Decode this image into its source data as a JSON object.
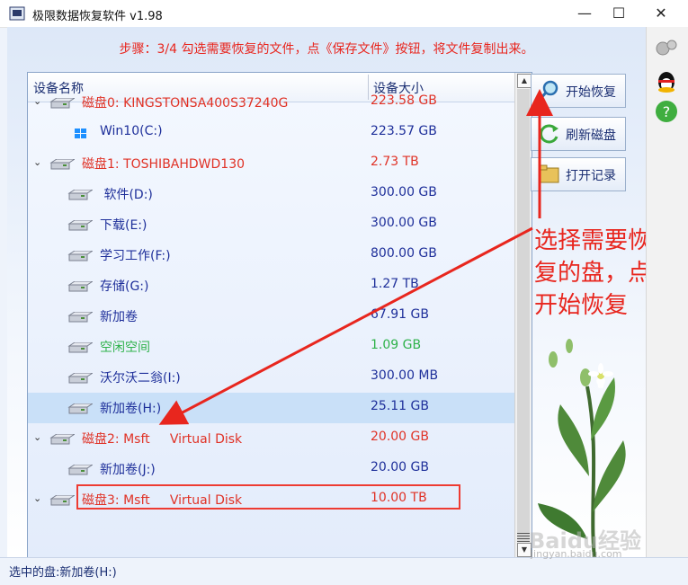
{
  "window": {
    "title": "极限数据恢复软件 v1.98",
    "minimize": "—",
    "maximize": "☐",
    "close": "✕"
  },
  "step_text": "步骤：3/4 勾选需要恢复的文件，点《保存文件》按钮，将文件复制出来。",
  "table": {
    "columns": [
      "设备名称",
      "设备大小"
    ],
    "rows": [
      {
        "name": "磁盘0: KINGSTONSA400S37240G",
        "size": "223.58 GB",
        "level": 0,
        "color": "#e03226",
        "icon": "hdd-icon"
      },
      {
        "name": "Win10(C:)",
        "size": "223.57 GB",
        "level": 1,
        "color": "#1e2f9a",
        "icon": "windows-icon"
      },
      {
        "name": "磁盘1: TOSHIBAHDWD130",
        "size": "2.73 TB",
        "level": 0,
        "color": "#e03226",
        "icon": "hdd-icon"
      },
      {
        "name": " 软件(D:)",
        "size": "300.00 GB",
        "level": 1,
        "color": "#1e2f9a",
        "icon": "drive-icon"
      },
      {
        "name": "下载(E:)",
        "size": "300.00 GB",
        "level": 1,
        "color": "#1e2f9a",
        "icon": "drive-icon"
      },
      {
        "name": "学习工作(F:)",
        "size": "800.00 GB",
        "level": 1,
        "color": "#1e2f9a",
        "icon": "drive-icon"
      },
      {
        "name": "存储(G:)",
        "size": "1.27 TB",
        "level": 1,
        "color": "#1e2f9a",
        "icon": "drive-icon"
      },
      {
        "name": "新加卷",
        "size": "67.91 GB",
        "level": 1,
        "color": "#1e2f9a",
        "icon": "drive-icon"
      },
      {
        "name": "空闲空间",
        "size": "1.09 GB",
        "level": 1,
        "color": "#2eb24a",
        "icon": "drive-icon"
      },
      {
        "name": "沃尔沃二翁(I:)",
        "size": "300.00 MB",
        "level": 1,
        "color": "#1e2f9a",
        "icon": "drive-icon"
      },
      {
        "name": "新加卷(H:)",
        "size": "25.11 GB",
        "level": 1,
        "color": "#1e2f9a",
        "icon": "drive-icon",
        "selected": true
      },
      {
        "name": "磁盘2: Msft     Virtual Disk",
        "size": "20.00 GB",
        "level": 0,
        "color": "#e03226",
        "icon": "hdd-icon"
      },
      {
        "name": "新加卷(J:)",
        "size": "20.00 GB",
        "level": 1,
        "color": "#1e2f9a",
        "icon": "drive-icon"
      },
      {
        "name": "磁盘3: Msft     Virtual Disk",
        "size": "10.00 TB",
        "level": 0,
        "color": "#e03226",
        "icon": "hdd-icon"
      }
    ]
  },
  "buttons": {
    "start": "开始恢复",
    "refresh": "刷新磁盘",
    "open_log": "打开记录"
  },
  "annotation": "选择需要恢复的盘，点开始恢复",
  "status": "选中的盘:新加卷(H:)",
  "watermark": {
    "text": "Baidu经验",
    "url": "jingyan.baidu.com"
  }
}
